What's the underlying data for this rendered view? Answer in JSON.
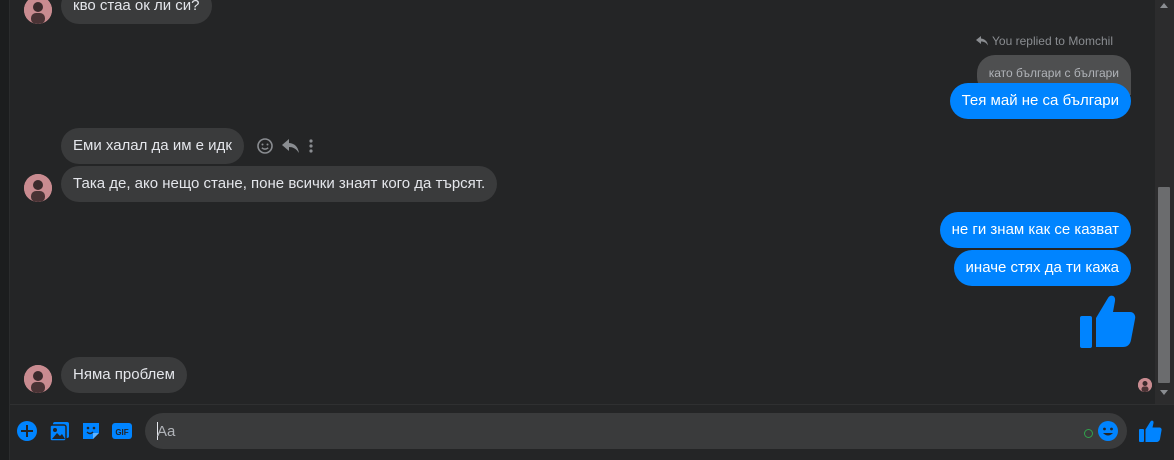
{
  "messages": {
    "first": "кво стаа ок ли си?",
    "reply_label": "You replied to Momchil",
    "quoted": "като българи с българи",
    "reply": "Тея май не са българи",
    "in_1": "Еми халал да им е идк",
    "in_2": "Така де, ако нещо стане, поне всички знаят кого да търсят.",
    "out_1": "не ги знам как се казват",
    "out_2": "иначе стях да ти кажа",
    "in_3": "Няма проблем"
  },
  "composer": {
    "placeholder": "Aa"
  },
  "colors": {
    "accent": "#0084ff",
    "incoming_bubble": "#3a3b3c",
    "background": "#242526"
  },
  "icons": [
    "plus-icon",
    "image-icon",
    "sticker-icon",
    "gif-icon",
    "emoji-icon",
    "thumbs-up-icon",
    "reply-icon",
    "more-icon",
    "react-icon"
  ]
}
